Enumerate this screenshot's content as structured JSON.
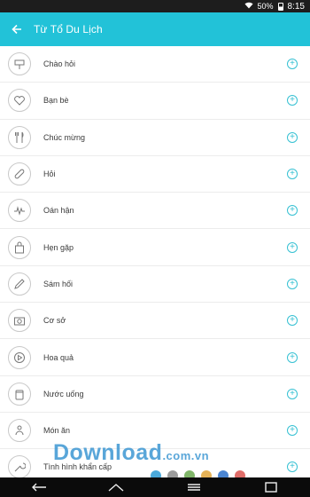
{
  "status": {
    "battery": "50%",
    "time": "8:15"
  },
  "header": {
    "title": "Từ Tổ Du Lịch"
  },
  "categories": [
    {
      "label": "Chào hỏi",
      "icon": "signpost-icon"
    },
    {
      "label": "Bạn bè",
      "icon": "heart-icon"
    },
    {
      "label": "Chúc mừng",
      "icon": "fork-knife-icon"
    },
    {
      "label": "Hỏi",
      "icon": "bandage-icon"
    },
    {
      "label": "Oán hận",
      "icon": "lightning-icon"
    },
    {
      "label": "Hẹn gặp",
      "icon": "bag-icon"
    },
    {
      "label": "Sám hối",
      "icon": "pencil-icon"
    },
    {
      "label": "Cơ sở",
      "icon": "camera-icon"
    },
    {
      "label": "Hoa quả",
      "icon": "play-icon"
    },
    {
      "label": "Nước uống",
      "icon": "jar-icon"
    },
    {
      "label": "Món ăn",
      "icon": "people-icon"
    },
    {
      "label": "Tình hình khẩn cấp",
      "icon": "wrench-icon"
    }
  ],
  "watermark": {
    "text": "Download",
    "suffix": ".com.vn"
  },
  "colors": {
    "accent": "#22c2d8",
    "plus": "#36c1d3",
    "dots": [
      "#2b9ad3",
      "#8a8a8a",
      "#6aa84f",
      "#e0a43a",
      "#2b70c9",
      "#d9534f"
    ]
  }
}
